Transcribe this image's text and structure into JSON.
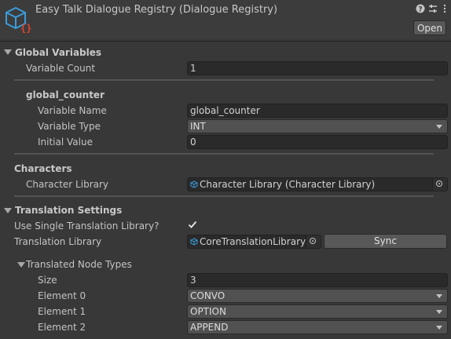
{
  "header": {
    "title": "Easy Talk Dialogue Registry (Dialogue Registry)",
    "open_label": "Open",
    "icons": [
      "help-icon",
      "settings-sliders-icon",
      "more-vertical-icon"
    ]
  },
  "global_variables": {
    "section_label": "Global Variables",
    "variable_count_label": "Variable Count",
    "variable_count_value": "1",
    "variable": {
      "header": "global_counter",
      "name_label": "Variable Name",
      "name_value": "global_counter",
      "type_label": "Variable Type",
      "type_value": "INT",
      "initial_label": "Initial Value",
      "initial_value": "0"
    }
  },
  "characters": {
    "section_label": "Characters",
    "library_label": "Character Library",
    "library_value": "Character Library (Character Library)"
  },
  "translation": {
    "section_label": "Translation Settings",
    "single_library_label": "Use Single Translation Library?",
    "single_library_checked": true,
    "library_label": "Translation Library",
    "library_value": "CoreTranslationLibrary (",
    "sync_label": "Sync",
    "node_types": {
      "label": "Translated Node Types",
      "size_label": "Size",
      "size_value": "3",
      "elements": [
        {
          "label": "Element 0",
          "value": "CONVO"
        },
        {
          "label": "Element 1",
          "value": "OPTION"
        },
        {
          "label": "Element 2",
          "value": "APPEND"
        }
      ]
    }
  },
  "colors": {
    "background": "#383838",
    "field": "#2a2a2a",
    "button": "#585858",
    "logo_blue": "#3a9bd9",
    "logo_red": "#e0452e"
  }
}
